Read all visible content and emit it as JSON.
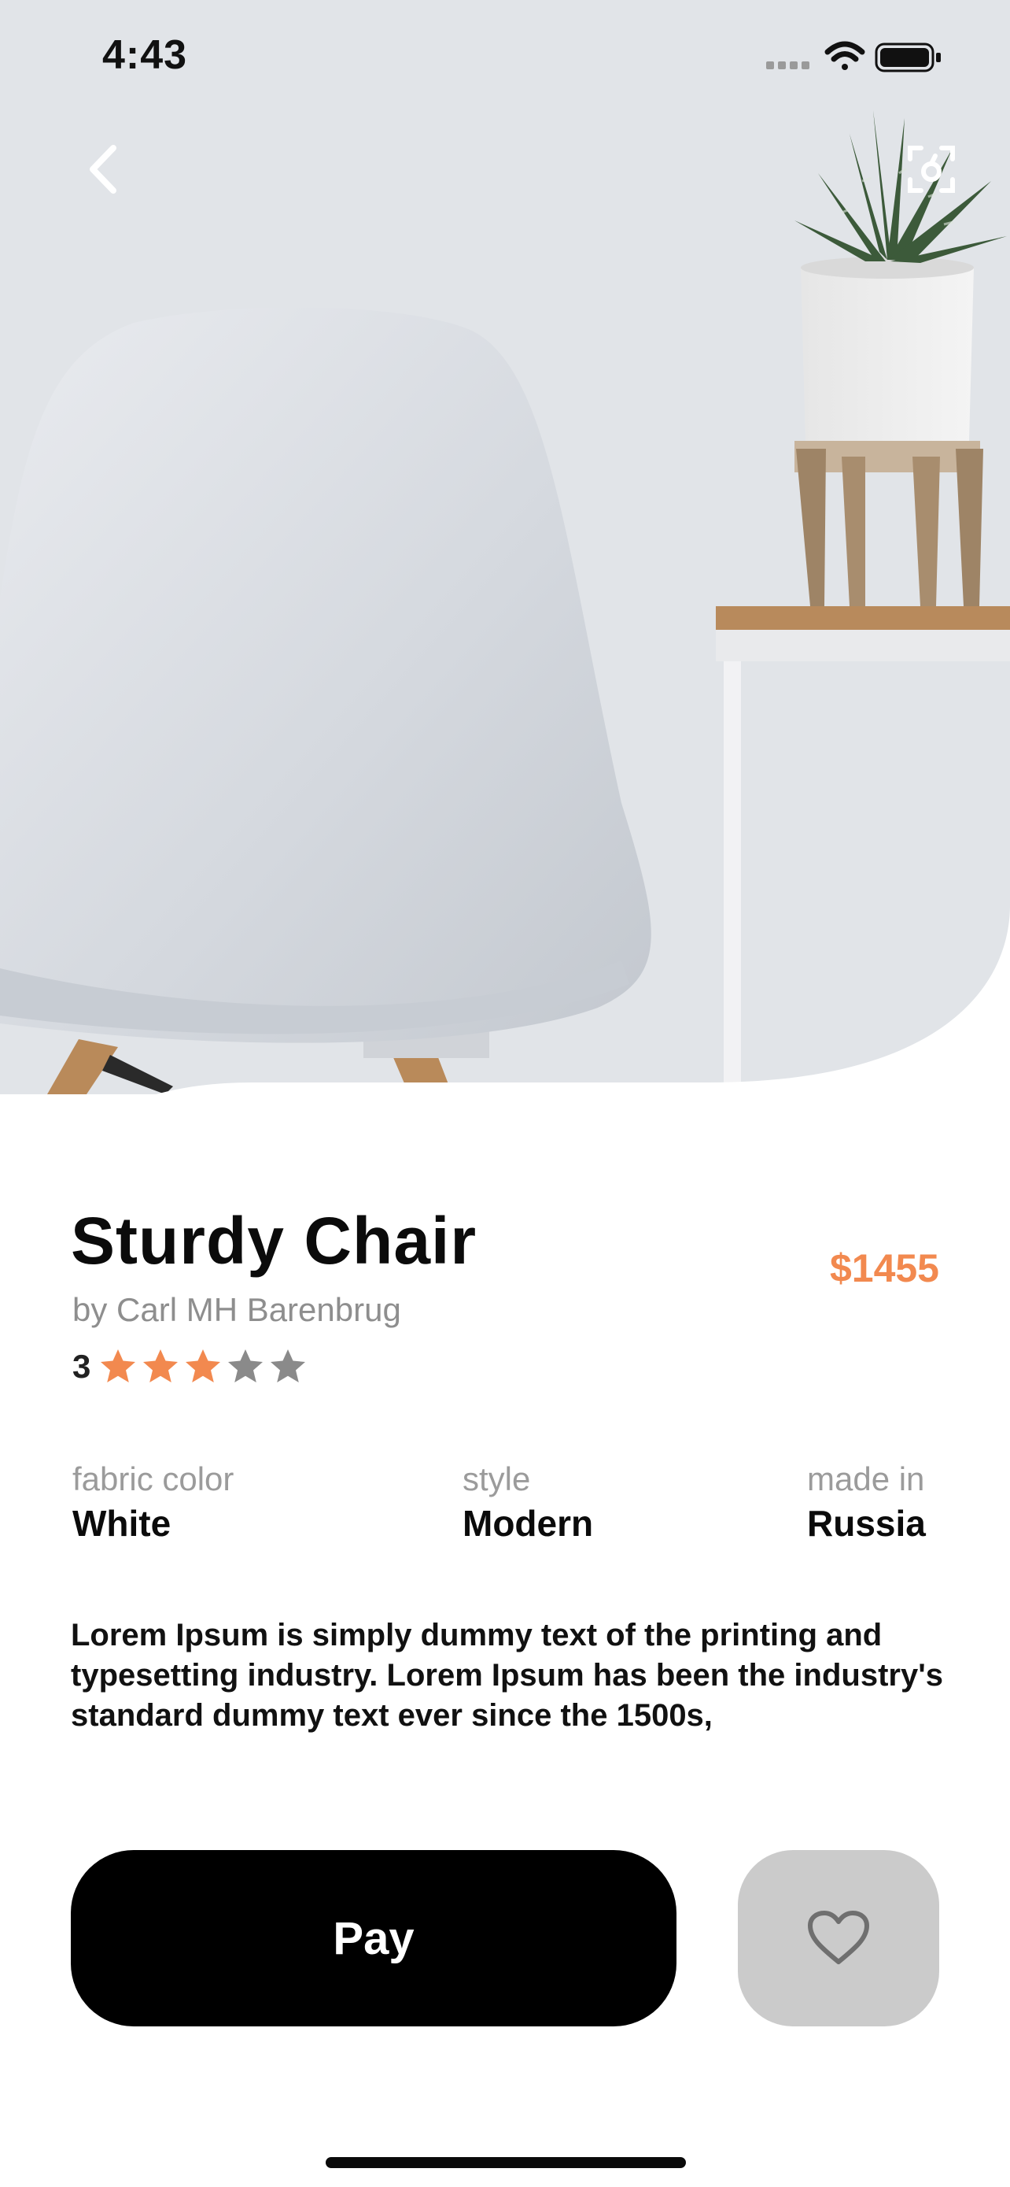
{
  "status_bar": {
    "time": "4:43",
    "icons": [
      "signal-icon",
      "wifi-icon",
      "battery-icon"
    ]
  },
  "nav": {
    "back_icon": "chevron-left-icon",
    "ar_icon": "ar-view-icon"
  },
  "product": {
    "title": "Sturdy Chair",
    "author": "by Carl MH Barenbrug",
    "price": "$1455",
    "rating": {
      "value": "3",
      "filled": 3,
      "max": 5
    }
  },
  "attributes": [
    {
      "label": "fabric color",
      "value": "White"
    },
    {
      "label": "style",
      "value": "Modern"
    },
    {
      "label": "made in",
      "value": "Russia"
    }
  ],
  "description": "Lorem Ipsum is simply dummy text of the printing and typesetting industry. Lorem Ipsum has been the industry's standard dummy text ever since the 1500s,",
  "actions": {
    "pay_label": "Pay",
    "favorite_icon": "heart-icon"
  },
  "colors": {
    "accent": "#f2894f",
    "star_filled": "#f2894f",
    "star_empty": "#8a8a8a",
    "pay_bg": "#000000",
    "fav_bg": "#cbcbcb"
  }
}
